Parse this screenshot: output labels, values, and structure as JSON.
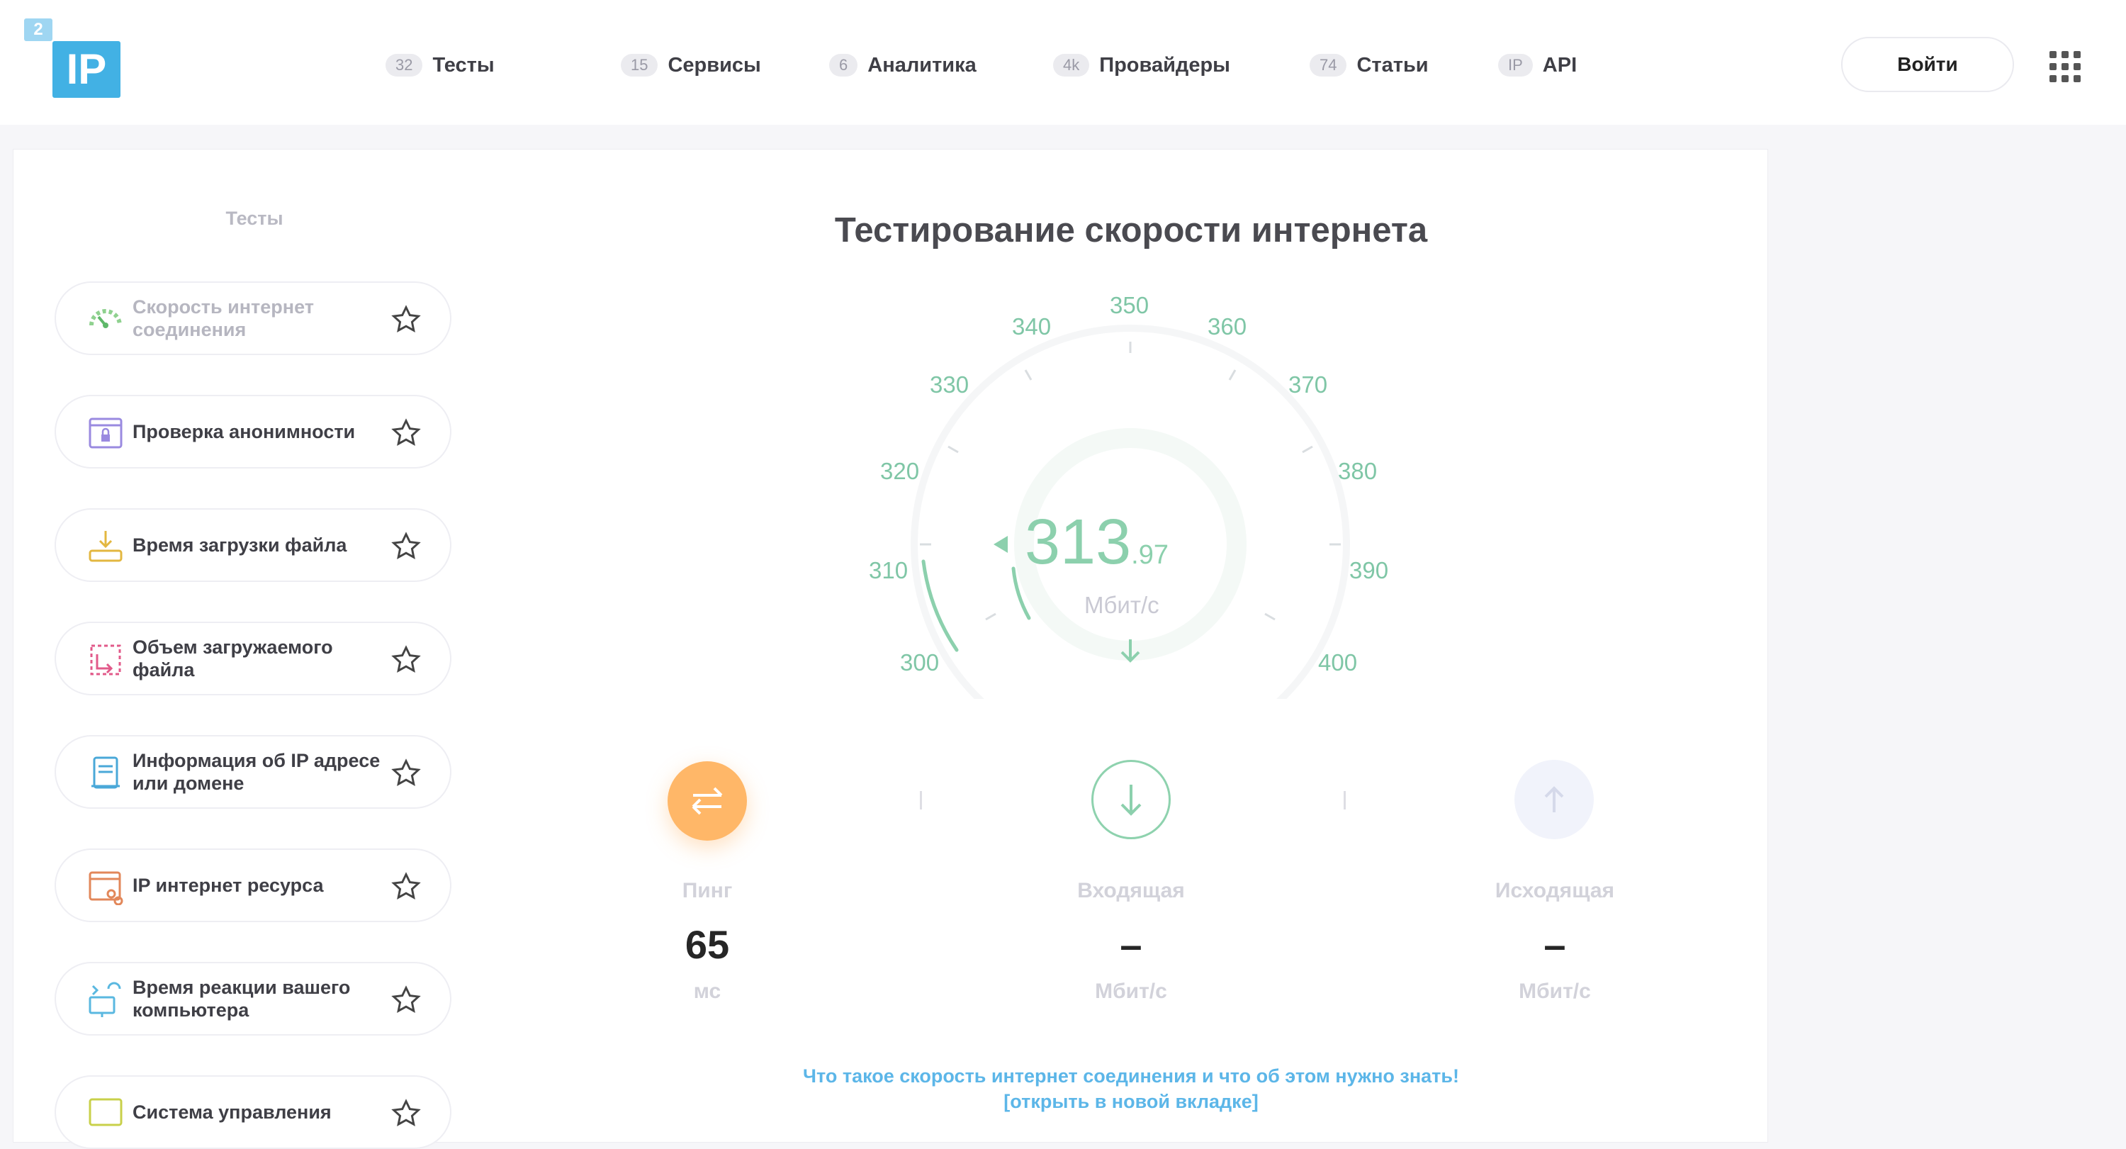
{
  "colors": {
    "accent_green": "#8cd0ad",
    "accent_orange": "#ffb768",
    "link_blue": "#5cb6e8",
    "logo_blue": "#42b1e4"
  },
  "logo": {
    "small": "2",
    "big": "IP"
  },
  "nav": [
    {
      "badge": "32",
      "label": "Тесты"
    },
    {
      "badge": "15",
      "label": "Сервисы"
    },
    {
      "badge": "6",
      "label": "Аналитика"
    },
    {
      "badge": "4k",
      "label": "Провайдеры"
    },
    {
      "badge": "74",
      "label": "Статьи"
    },
    {
      "badge": "IP",
      "label": "API"
    }
  ],
  "header": {
    "login_label": "Войти",
    "apps_icon": "grid-icon"
  },
  "sidebar": {
    "title": "Тесты",
    "items": [
      {
        "label": "Скорость интернет соединения",
        "icon": "speedometer-icon",
        "active": true
      },
      {
        "label": "Проверка анонимности",
        "icon": "browser-lock-icon"
      },
      {
        "label": "Время загрузки файла",
        "icon": "download-tray-icon"
      },
      {
        "label": "Объем загружаемого файла",
        "icon": "file-size-icon"
      },
      {
        "label": "Информация об IP адресе или домене",
        "icon": "document-icon"
      },
      {
        "label": "IP интернет ресурса",
        "icon": "browser-link-icon"
      },
      {
        "label": "Время реакции вашего компьютера",
        "icon": "monitor-sync-icon"
      },
      {
        "label": "Система управления",
        "icon": "cms-icon"
      }
    ]
  },
  "main": {
    "title": "Тестирование скорости интернета",
    "gauge": {
      "ticks": [
        "300",
        "310",
        "320",
        "330",
        "340",
        "350",
        "360",
        "370",
        "380",
        "390",
        "400"
      ],
      "value_int": "313",
      "value_dec": ".97",
      "unit": "Мбит/с"
    },
    "metrics": {
      "ping": {
        "label": "Пинг",
        "value": "65",
        "unit": "мс"
      },
      "download": {
        "label": "Входящая",
        "value": "–",
        "unit": "Мбит/с"
      },
      "upload": {
        "label": "Исходящая",
        "value": "–",
        "unit": "Мбит/с"
      }
    },
    "info_link": "Что такое скорость интернет соединения и что об этом нужно знать!",
    "info_link2": "[открыть в новой вкладке]"
  }
}
